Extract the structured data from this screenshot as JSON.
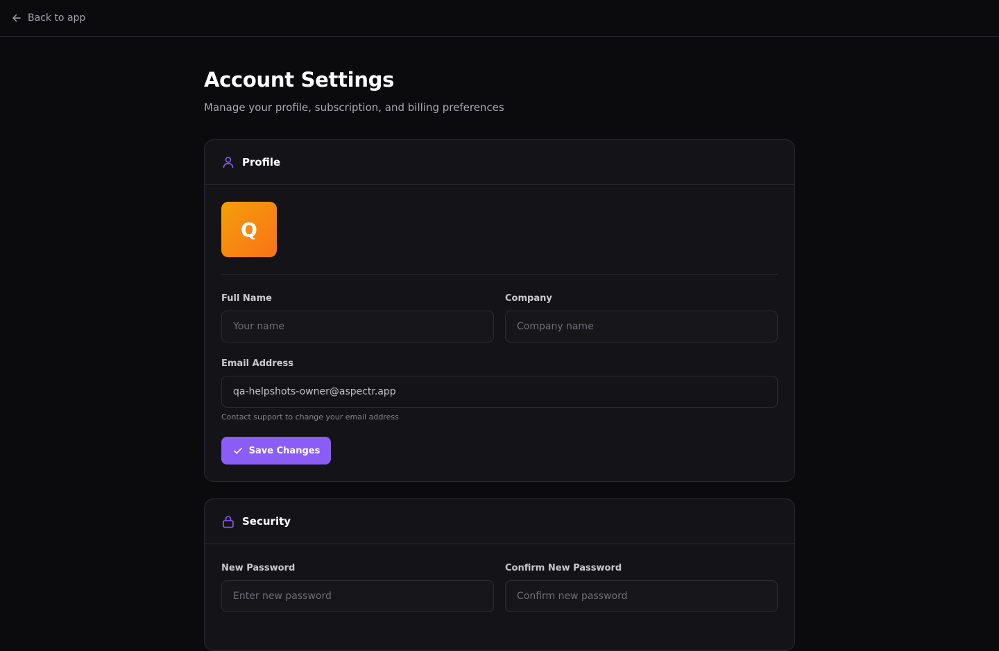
{
  "topbar": {
    "back_label": "Back to app",
    "back_icon": "arrow-left-icon"
  },
  "page": {
    "title": "Account Settings",
    "subtitle": "Manage your profile, subscription, and billing preferences"
  },
  "profile": {
    "title": "Profile",
    "icon": "user-icon",
    "avatar_initial": "Q",
    "full_name": {
      "label": "Full Name",
      "placeholder": "Your name",
      "value": ""
    },
    "company": {
      "label": "Company",
      "placeholder": "Company name",
      "value": ""
    },
    "email": {
      "label": "Email Address",
      "value": "qa-helpshots-owner@aspectr.app",
      "hint": "Contact support to change your email address"
    },
    "save_label": "Save Changes",
    "save_icon": "check-icon"
  },
  "security": {
    "title": "Security",
    "icon": "lock-icon",
    "new_password": {
      "label": "New Password",
      "placeholder": "Enter new password"
    },
    "confirm_password": {
      "label": "Confirm New Password",
      "placeholder": "Confirm new password"
    }
  },
  "colors": {
    "background": "#0b0b0d",
    "card": "#141418",
    "border": "#2a2a30",
    "accent": "#8b5cf6",
    "avatar_gradient_start": "#f59e0b",
    "avatar_gradient_end": "#f97316"
  }
}
